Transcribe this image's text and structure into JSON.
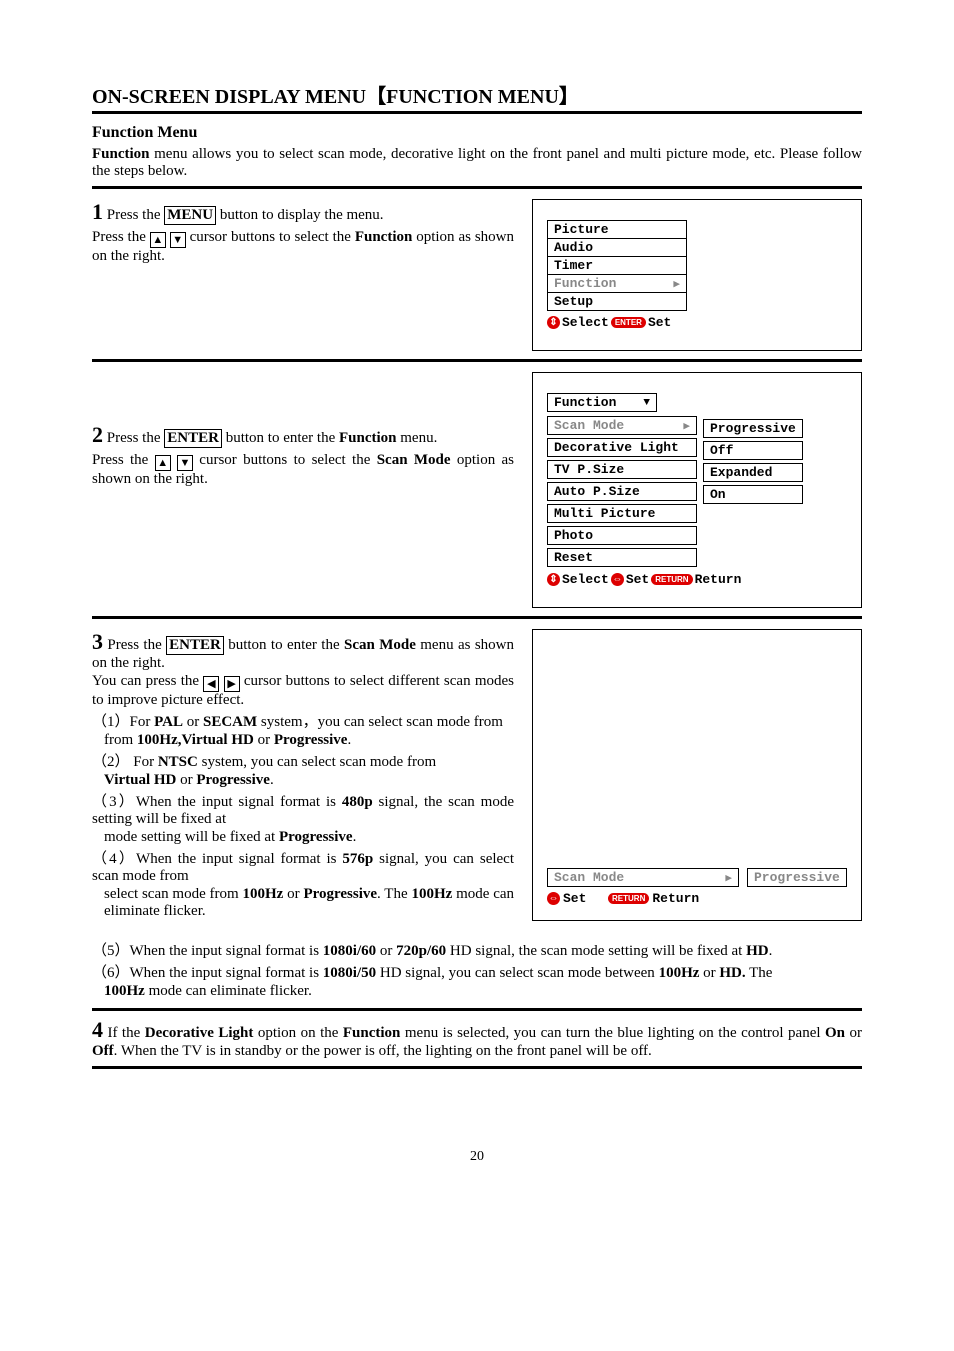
{
  "title": "ON-SCREEN DISPLAY MENU",
  "title_bracket": "【FUNCTION MENU】",
  "subtitle": "Function Menu",
  "intro_bold": "Function",
  "intro_rest": " menu allows you to select scan mode, decorative light on the front panel and multi picture mode, etc. Please follow the steps below.",
  "step1": {
    "num": "1",
    "a": " Press the ",
    "btn": "MENU",
    "b": " button to display the menu.",
    "c": "Press the ",
    "d": " cursor buttons to select the ",
    "e": "Function",
    "f": " option as shown on the right."
  },
  "menu1": {
    "items": [
      "Picture",
      "Audio",
      "Timer",
      "Function",
      "Setup"
    ],
    "footer_select": "Select",
    "footer_enter": "ENTER",
    "footer_set": "Set"
  },
  "step2": {
    "num": "2",
    "a": " Press the ",
    "btn": "ENTER",
    "b": " button to enter the ",
    "c": "Function",
    "d": " menu.",
    "e": "Press the ",
    "f": " cursor buttons to select the ",
    "g": "Scan Mode",
    "h": " option as shown on the right."
  },
  "menu2": {
    "head": "Function",
    "items": [
      "Scan Mode",
      "Decorative Light",
      "TV P.Size",
      "Auto P.Size",
      "Multi Picture",
      "Photo",
      "Reset"
    ],
    "vals": [
      "Progressive",
      "Off",
      "Expanded",
      "On"
    ],
    "footer_select": "Select",
    "footer_set": "Set",
    "footer_return_pill": "RETURN",
    "footer_return": "Return"
  },
  "step3": {
    "num": "3",
    "a": " Press the ",
    "btn": "ENTER",
    "b": " button to enter the ",
    "c": "Scan Mode",
    "d": " menu as shown on the right.",
    "e": "You can press the ",
    "f": " cursor buttons to select different scan modes to improve picture effect.",
    "p1a": "（1）For ",
    "p1b": "PAL",
    "p1c": " or ",
    "p1d": "SECAM",
    "p1e": " system，you can select scan mode from ",
    "p1f": "100Hz,Virtual HD",
    "p1g": " or ",
    "p1h": "Progressive",
    "p1i": ".",
    "p2a": "（2） For ",
    "p2b": "NTSC",
    "p2c": " system, you can select scan mode from ",
    "p2d": "Virtual HD",
    "p2e": " or ",
    "p2f": "Progressive",
    "p2g": ".",
    "p3a": "（3）When the input signal format is ",
    "p3b": "480p",
    "p3c": " signal, the scan mode setting will be fixed at ",
    "p3d": "Progressive",
    "p3e": ".",
    "p4a": "（4）When the input signal format is ",
    "p4b": "576p",
    "p4c": " signal, you can select scan mode from ",
    "p4d": "100Hz",
    "p4e": " or ",
    "p4f": "Progressive",
    "p4g": ". The ",
    "p4h": "100Hz",
    "p4i": " mode can eliminate flicker.",
    "p5a": "（5）When the input signal format is ",
    "p5b": "1080i/60",
    "p5c": " or ",
    "p5d": "720p/60",
    "p5e": " HD signal, the scan mode setting will be fixed at ",
    "p5f": "HD",
    "p5g": ".",
    "p6a": "（6）When the input signal format is ",
    "p6b": "1080i/50",
    "p6c": " HD signal, you can select scan mode between ",
    "p6d": "100Hz",
    "p6e": " or ",
    "p6f": "HD.",
    "p6g": " The ",
    "p6h": "100Hz",
    "p6i": " mode can eliminate flicker."
  },
  "menu3": {
    "label": "Scan Mode",
    "val": "Progressive",
    "footer_set": "Set",
    "footer_return_pill": "RETURN",
    "footer_return": "Return"
  },
  "step4": {
    "num": "4",
    "a": " If the ",
    "b": "Decorative Light",
    "c": " option on the ",
    "d": "Function",
    "e": " menu is selected, you can turn the blue lighting on the control panel ",
    "f": "On",
    "g": " or ",
    "h": "Off",
    "i": ". When the TV is in standby or the power is off, the lighting on the front panel will be off."
  },
  "page_num": "20",
  "arrows": {
    "up": "▲",
    "down": "▼",
    "left": "◀",
    "right": "▶",
    "updown": "⇕",
    "leftright": "⇔"
  }
}
